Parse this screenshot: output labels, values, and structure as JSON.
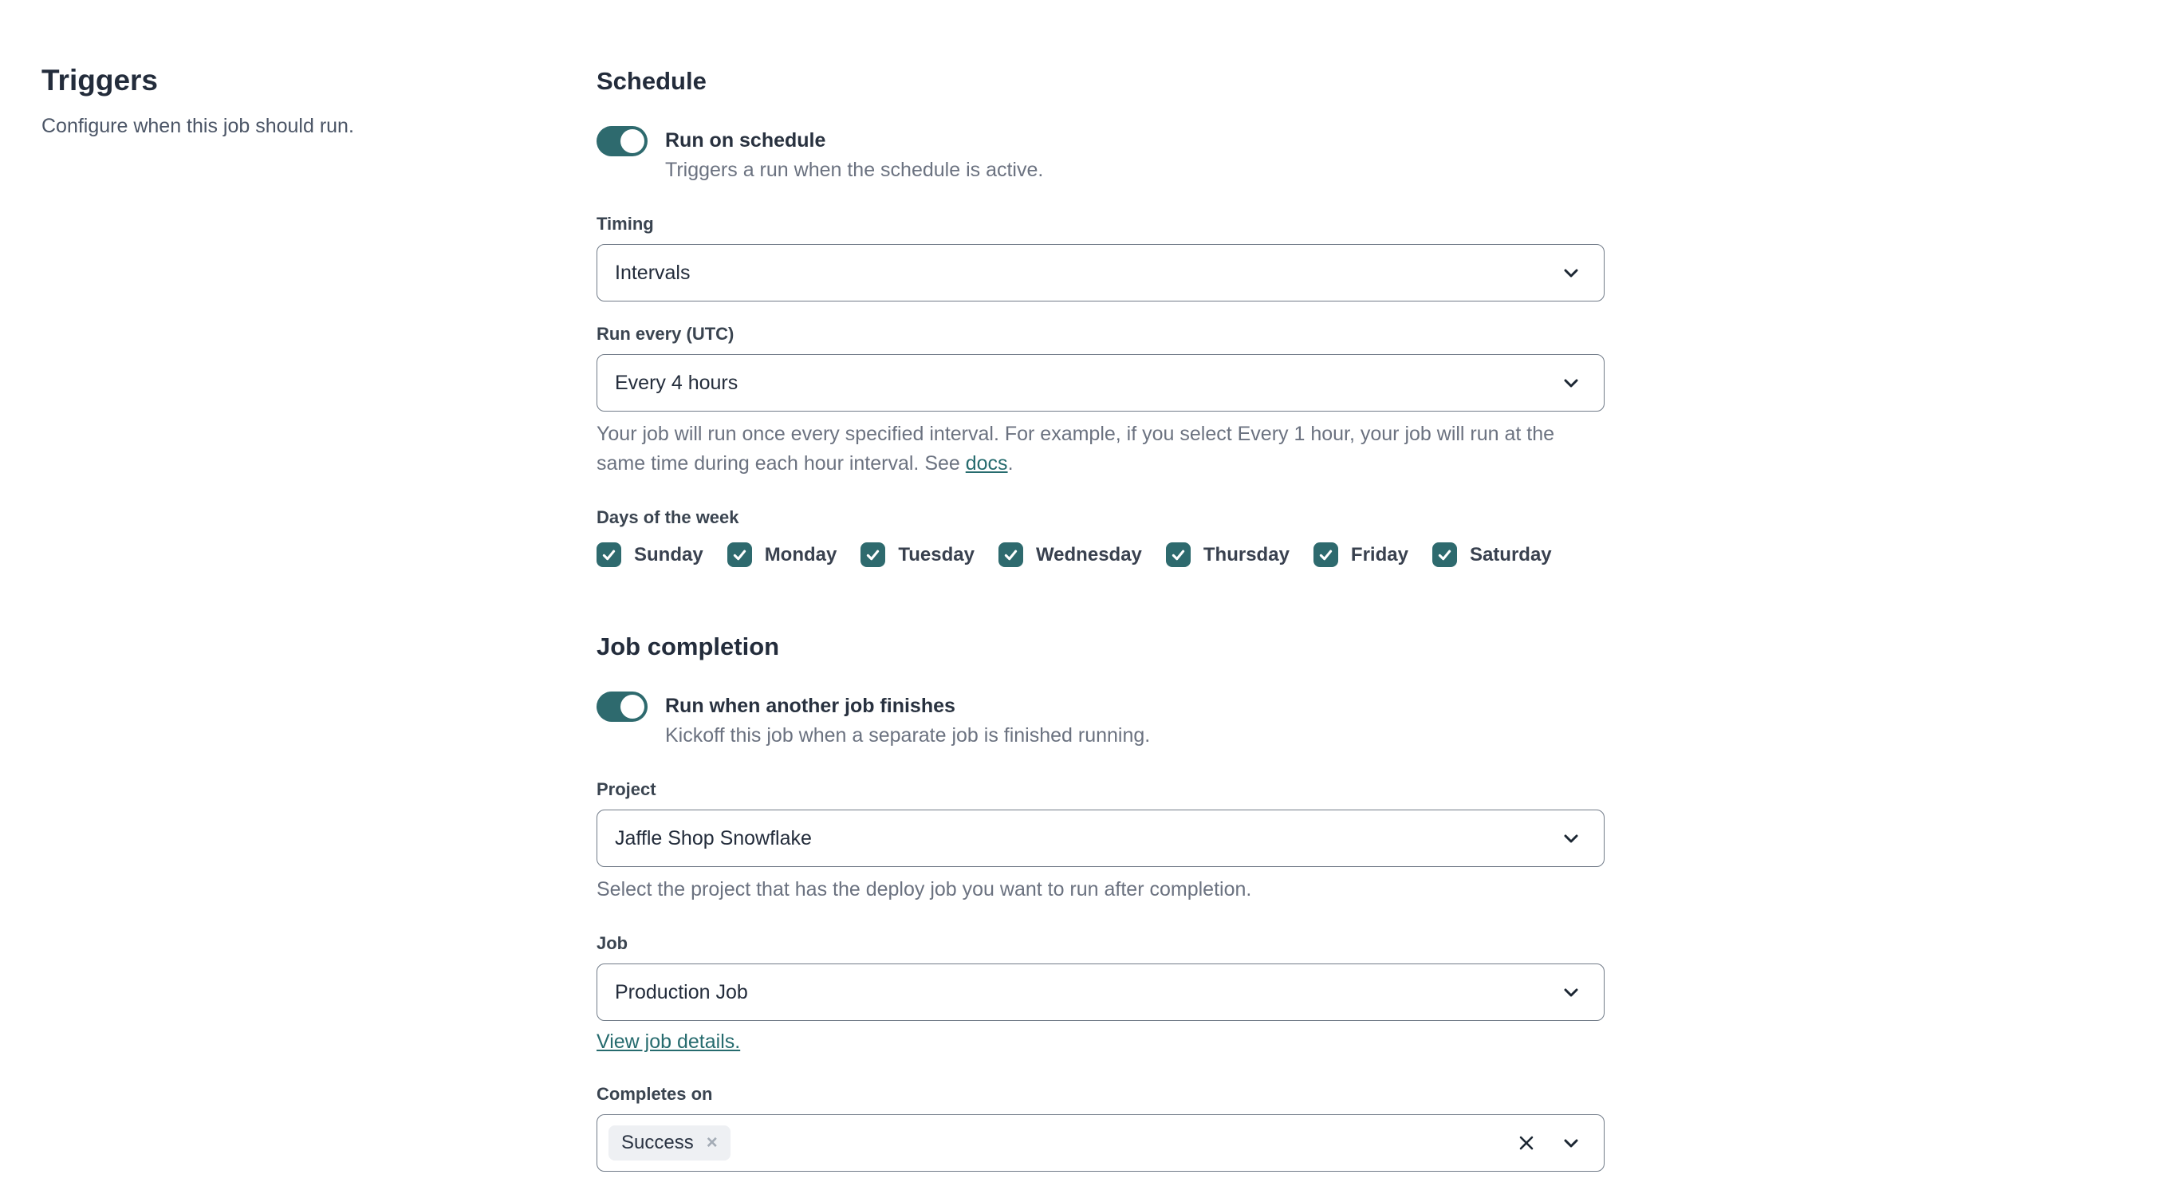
{
  "colors": {
    "accent_teal": "#2e6a6e",
    "link_teal": "#266b6e",
    "heading_text": "#232c3b",
    "body_gray": "#6b7280",
    "label_text": "#3a4450",
    "border_gray": "#717b88",
    "chip_bg": "#eef0f3"
  },
  "left_panel": {
    "title": "Triggers",
    "subtitle": "Configure when this job should run."
  },
  "schedule": {
    "heading": "Schedule",
    "run_on_schedule": {
      "label": "Run on schedule",
      "description": "Triggers a run when the schedule is active.",
      "enabled": true
    },
    "timing": {
      "label": "Timing",
      "selected": "Intervals"
    },
    "run_every": {
      "label": "Run every (UTC)",
      "selected": "Every 4 hours",
      "help_text": "Your job will run once every specified interval. For example, if you select Every 1 hour, your job will run at the same time during each hour interval. See ",
      "help_link_label": "docs",
      "help_suffix": "."
    },
    "days_of_week": {
      "label": "Days of the week",
      "items": [
        {
          "label": "Sunday",
          "checked": true
        },
        {
          "label": "Monday",
          "checked": true
        },
        {
          "label": "Tuesday",
          "checked": true
        },
        {
          "label": "Wednesday",
          "checked": true
        },
        {
          "label": "Thursday",
          "checked": true
        },
        {
          "label": "Friday",
          "checked": true
        },
        {
          "label": "Saturday",
          "checked": true
        }
      ]
    }
  },
  "job_completion": {
    "heading": "Job completion",
    "run_when_finished": {
      "label": "Run when another job finishes",
      "description": "Kickoff this job when a separate job is finished running.",
      "enabled": true
    },
    "project": {
      "label": "Project",
      "selected": "Jaffle Shop Snowflake",
      "help_text": "Select the project that has the deploy job you want to run after completion."
    },
    "job": {
      "label": "Job",
      "selected": "Production Job",
      "link_label": "View job details."
    },
    "completes_on": {
      "label": "Completes on",
      "selected_chips": [
        {
          "label": "Success"
        }
      ]
    }
  }
}
